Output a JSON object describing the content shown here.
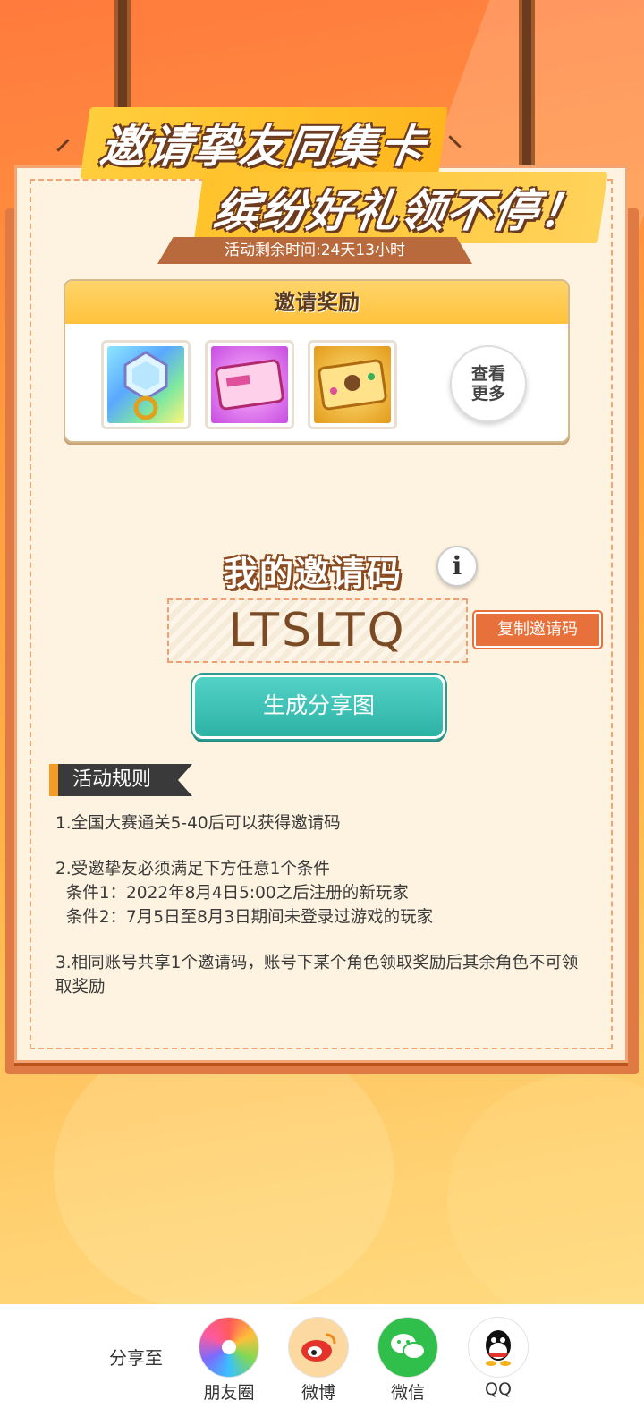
{
  "header": {
    "title_line1": "邀请挚友同集卡",
    "title_line2": "缤纷好礼领不停！",
    "timer": "活动剩余时间:24天13小时"
  },
  "rewards": {
    "title": "邀请奖励",
    "items": [
      {
        "name": "ring-reward"
      },
      {
        "name": "pink-card-reward"
      },
      {
        "name": "gold-card-reward"
      }
    ],
    "see_more": "查看更多"
  },
  "invite": {
    "title": "我的邀请码",
    "info_icon": "i",
    "code": "LTSLTQ",
    "copy_label": "复制邀请码",
    "generate_label": "生成分享图"
  },
  "rules": {
    "title": "活动规则",
    "items": [
      "1.全国大赛通关5-40后可以获得邀请码",
      "2.受邀挚友必须满足下方任意1个条件\n  条件1：2022年8月4日5:00之后注册的新玩家\n  条件2：7月5日至8月3日期间未登录过游戏的玩家",
      "3.相同账号共享1个邀请码，账号下某个角色领取奖励后其余角色不可领取奖励"
    ]
  },
  "share": {
    "label": "分享至",
    "targets": [
      {
        "name": "朋友圈",
        "icon": "moments-icon"
      },
      {
        "name": "微博",
        "icon": "weibo-icon"
      },
      {
        "name": "微信",
        "icon": "wechat-icon"
      },
      {
        "name": "QQ",
        "icon": "qq-icon"
      }
    ]
  }
}
